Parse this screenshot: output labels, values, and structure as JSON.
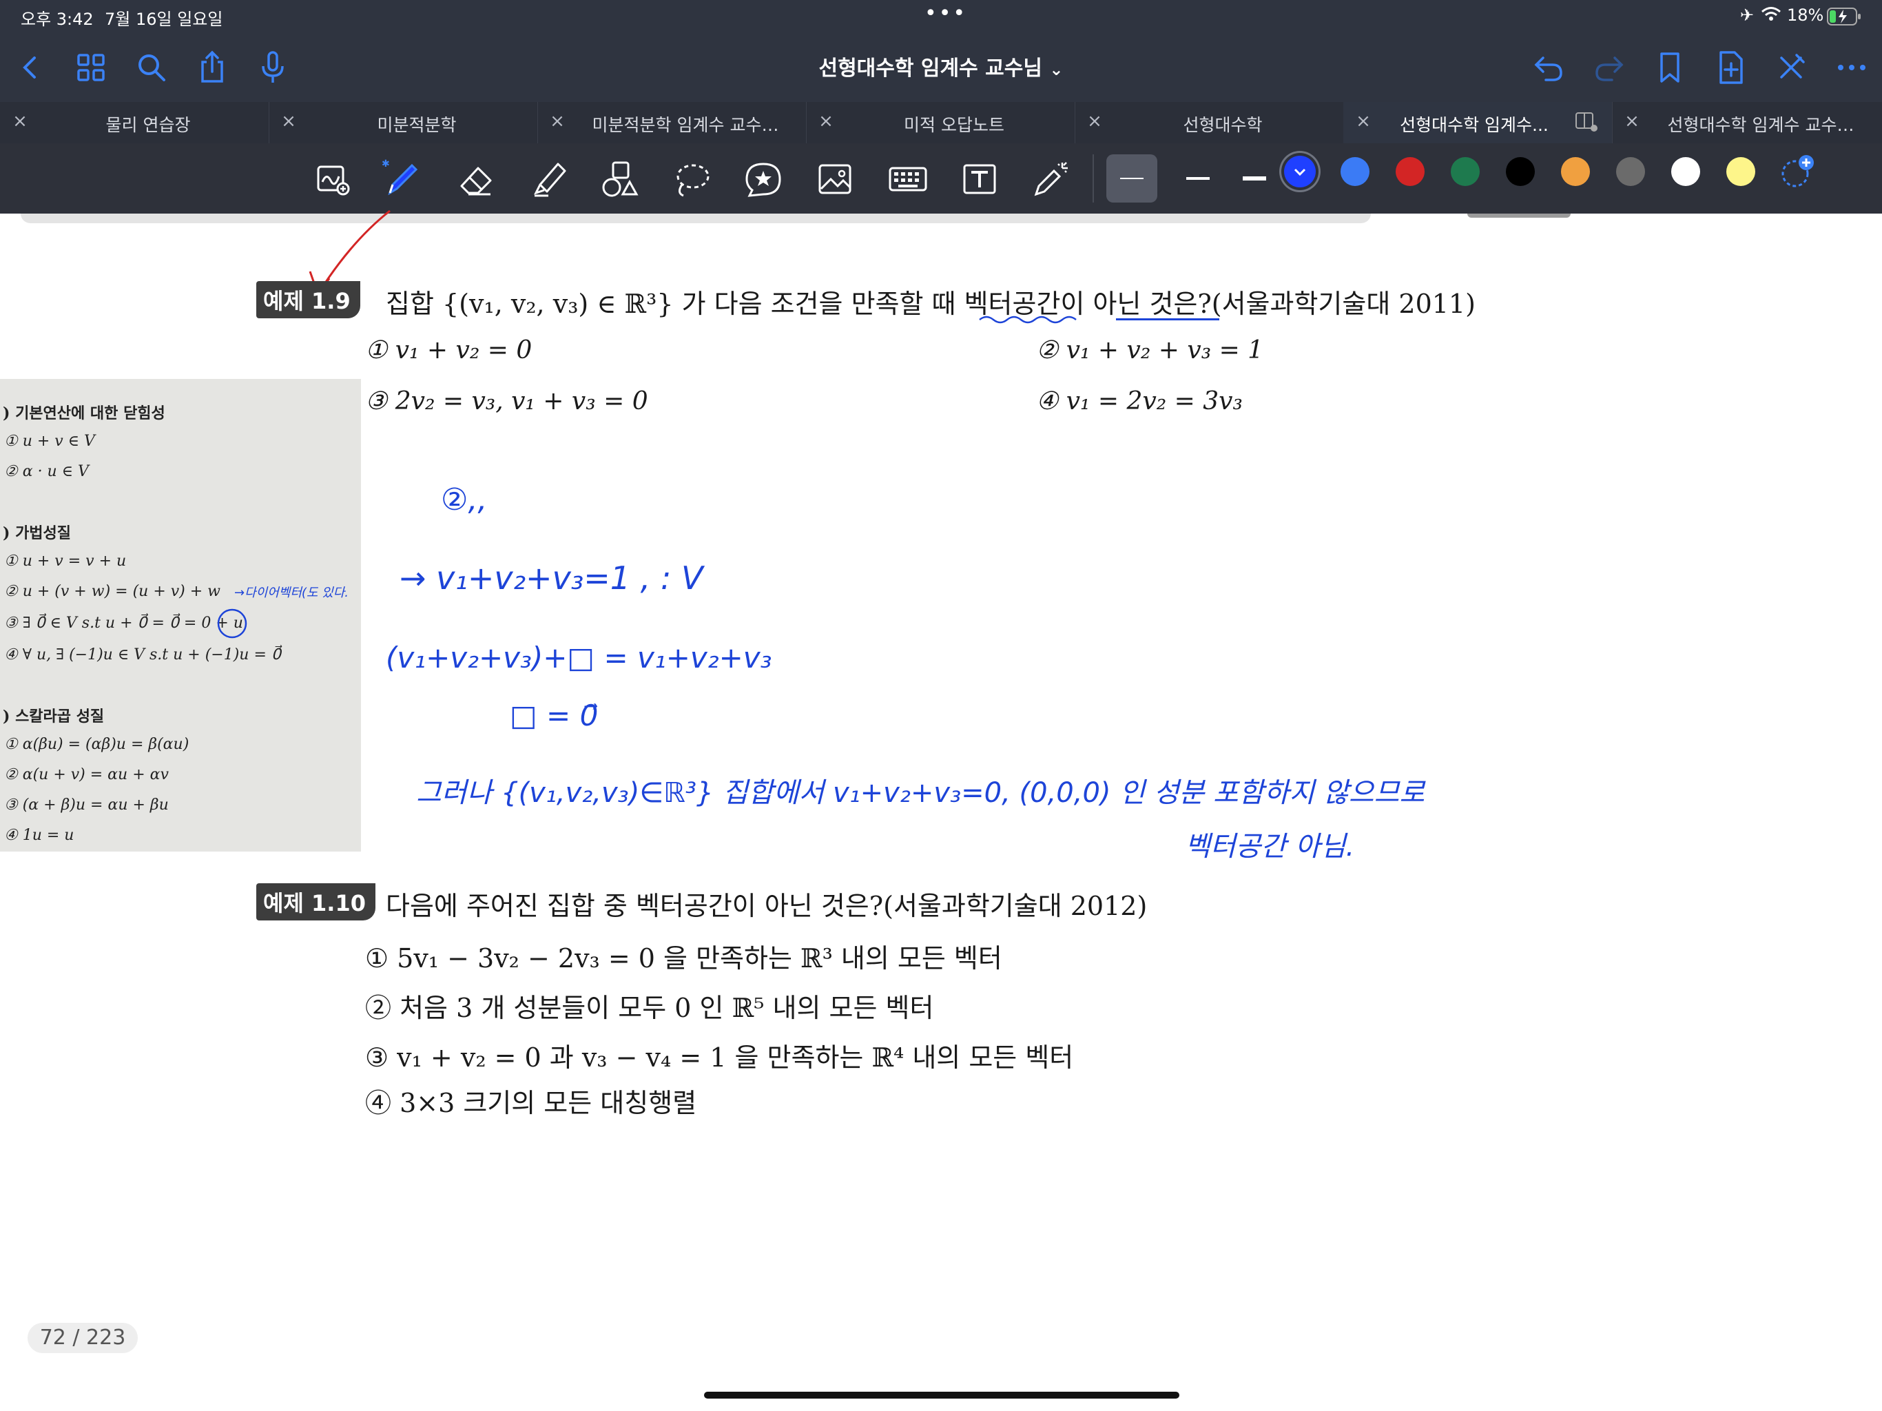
{
  "status_bar": {
    "time": "오후 3:42",
    "date": "7월 16일 일요일",
    "battery": "18%"
  },
  "nav": {
    "title": "선형대수학 임계수 교수님",
    "title_chevron": "⌄"
  },
  "tabs": [
    {
      "label": "물리 연습장",
      "active": false
    },
    {
      "label": "미분적분학",
      "active": false
    },
    {
      "label": "미분적분학 임계수 교수…",
      "active": false
    },
    {
      "label": "미적 오답노트",
      "active": false
    },
    {
      "label": "선형대수학",
      "active": false
    },
    {
      "label": "선형대수학 임계수...",
      "active": true
    },
    {
      "label": "선형대수학 임계수 교수…",
      "active": false
    }
  ],
  "colors": {
    "accent": "#3b82f6",
    "swatches": [
      "#1f40ff",
      "#3b7bf5",
      "#d32525",
      "#1e7a4e",
      "#000000",
      "#f0a040",
      "#6b6b6b",
      "#ffffff",
      "#fdf58a"
    ],
    "ink": "#1d44d8"
  },
  "problem_1_9": {
    "badge": "예제 1.9",
    "question": "집합 {(v₁, v₂, v₃) ∈ ℝ³} 가 다음 조건을 만족할 때 벡터공간이 아닌 것은?(서울과학기술대 2011)",
    "options": [
      "① v₁ + v₂ = 0",
      "② v₁ + v₂ + v₃ = 1",
      "③ 2v₂ = v₃,  v₁ + v₃ = 0",
      "④ v₁ = 2v₂ = 3v₃"
    ]
  },
  "sidebar_box": {
    "items": [
      ") 기본연산에 대한 닫힘성",
      "① u + v ∈ V",
      "② α · u ∈ V",
      ") 가법성질",
      "① u + v = v + u",
      "② u + (v + w) = (u + v) + w",
      "③ ∃ 0⃗ ∈ V s.t u + 0⃗ = 0⃗ = 0 + u",
      "④ ∀ u,  ∃ (−1)u ∈ V s.t u + (−1)u = 0⃗",
      ") 스칼라곱 성질",
      "① α(βu) = (αβ)u = β(αu)",
      "② α(u + v) = αu + αv",
      "③ (α + β)u = αu + βu",
      "④ 1u = u"
    ],
    "note": "→다이어벡터(도 있다."
  },
  "handwriting": {
    "line1": "②,,",
    "line2": "→  v₁+v₂+v₃=1 ,   : V",
    "line3": "(v₁+v₂+v₃)+□ = v₁+v₂+v₃",
    "line4": "□ = 0⃗",
    "line5": "그러나  {(v₁,v₂,v₃)∈ℝ³} 집합에서  v₁+v₂+v₃=0, (0,0,0) 인 성분 포함하지 않으므로",
    "line6": "벡터공간 아님."
  },
  "problem_1_10": {
    "badge": "예제 1.10",
    "question": "다음에 주어진 집합 중 벡터공간이 아닌 것은?(서울과학기술대 2012)",
    "options": [
      "① 5v₁ − 3v₂ − 2v₃ = 0 을 만족하는 ℝ³ 내의 모든 벡터",
      "② 처음 3 개 성분들이 모두 0 인 ℝ⁵ 내의 모든 벡터",
      "③ v₁ + v₂ = 0 과 v₃ − v₄ = 1 을 만족하는 ℝ⁴ 내의 모든 벡터",
      "④ 3×3 크기의 모든 대칭행렬"
    ]
  },
  "page_indicator": "72 / 223"
}
